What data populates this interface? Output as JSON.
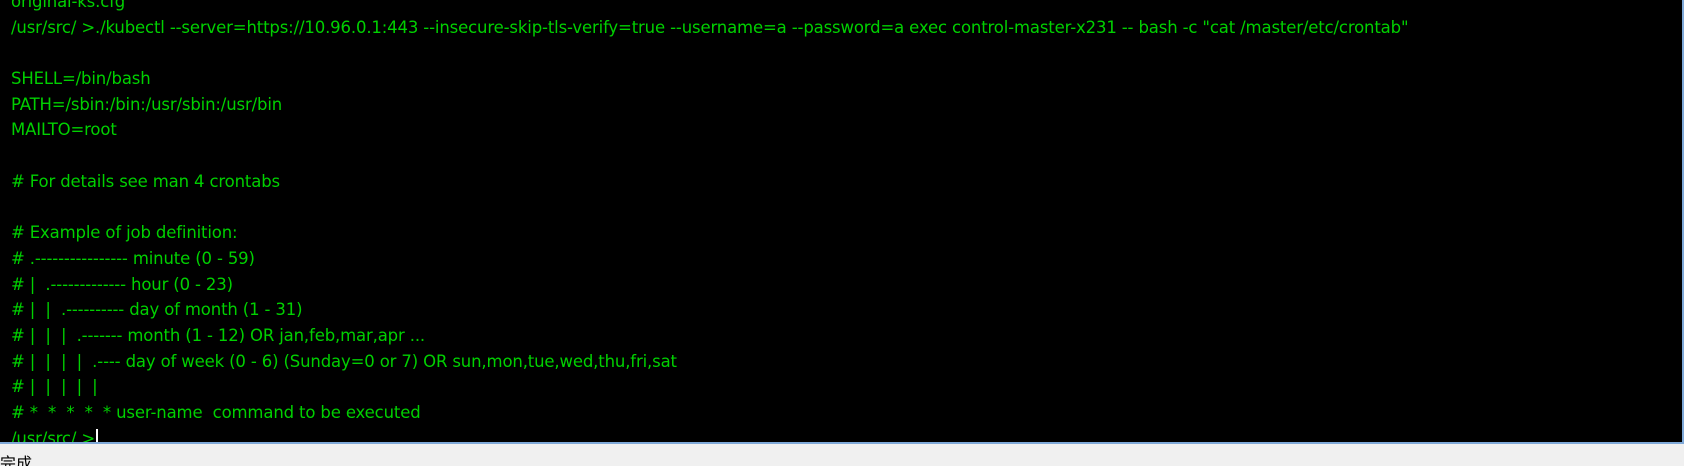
{
  "terminal": {
    "text_color": "#00d000",
    "background": "#000000",
    "lines": [
      "original-ks.cfg",
      "/usr/src/ >./kubectl --server=https://10.96.0.1:443 --insecure-skip-tls-verify=true --username=a --password=a exec control-master-x231 -- bash -c \"cat /master/etc/crontab\"",
      "",
      "SHELL=/bin/bash",
      "PATH=/sbin:/bin:/usr/sbin:/usr/bin",
      "MAILTO=root",
      "",
      "# For details see man 4 crontabs",
      "",
      "# Example of job definition:",
      "# .---------------- minute (0 - 59)",
      "# |  .------------- hour (0 - 23)",
      "# |  |  .---------- day of month (1 - 31)",
      "# |  |  |  .------- month (1 - 12) OR jan,feb,mar,apr ...",
      "# |  |  |  |  .---- day of week (0 - 6) (Sunday=0 or 7) OR sun,mon,tue,wed,thu,fri,sat",
      "# |  |  |  |  |",
      "# *  *  *  *  * user-name  command to be executed"
    ],
    "prompt": "/usr/src/ >"
  },
  "status_bar": {
    "text": "完成"
  }
}
